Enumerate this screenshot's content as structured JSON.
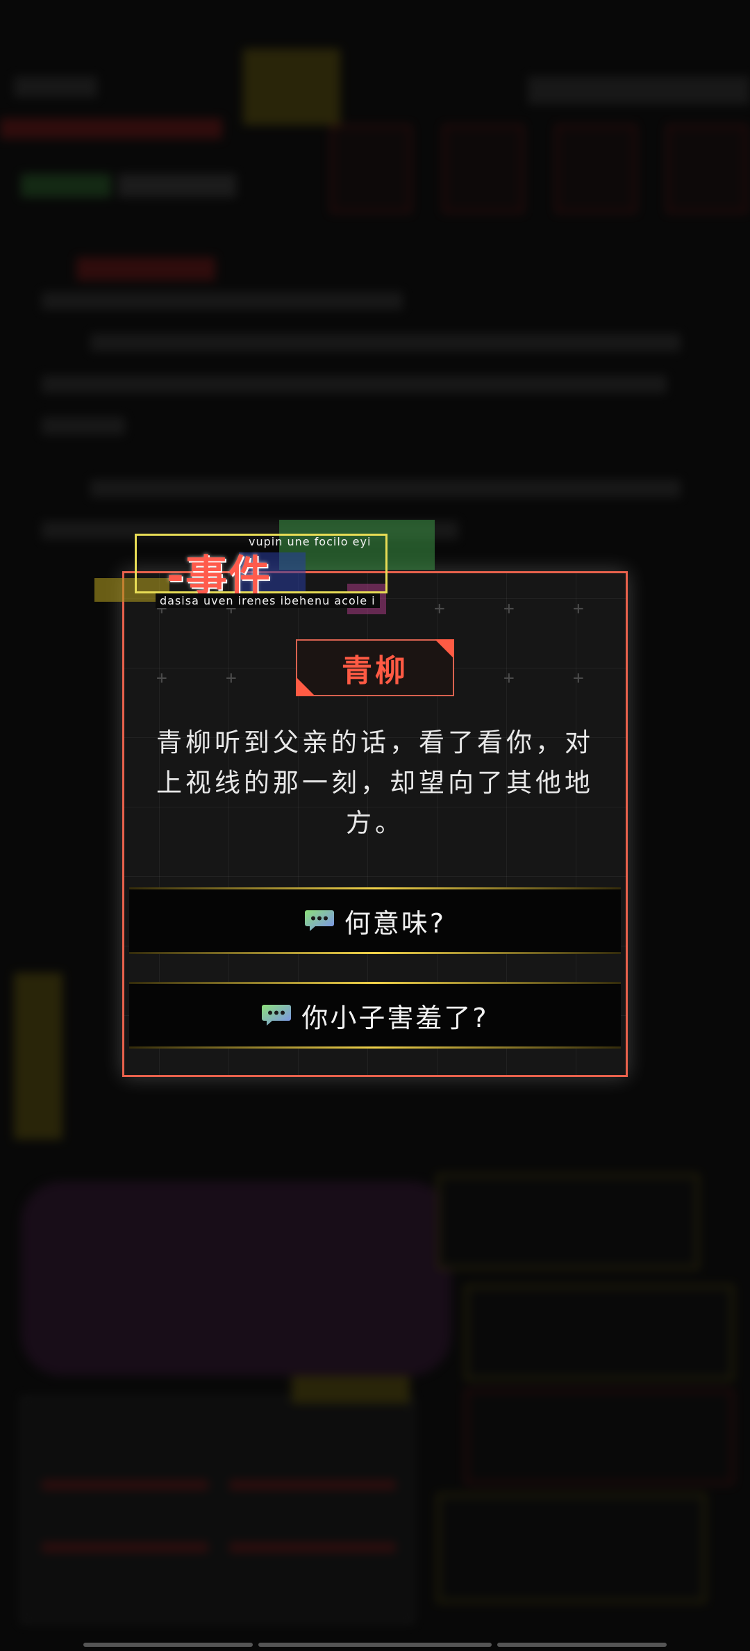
{
  "event": {
    "tag_top": "vupin une focilo eyi",
    "title": "-事件",
    "tag_bottom": "dasisa uven irenes ibehenu acole i",
    "speaker": "青柳",
    "narrative": "青柳听到父亲的话，看了看你，对上视线的那一刻，却望向了其他地方。",
    "choices": [
      {
        "label": "何意味?",
        "icon": "chat-bubble-icon"
      },
      {
        "label": "你小子害羞了?",
        "icon": "chat-bubble-icon"
      }
    ]
  },
  "colors": {
    "accent_red": "#ff5b44",
    "frame_red": "#e8614c",
    "tag_yellow": "#e7dc55",
    "choice_gold": "#f0d24a"
  }
}
